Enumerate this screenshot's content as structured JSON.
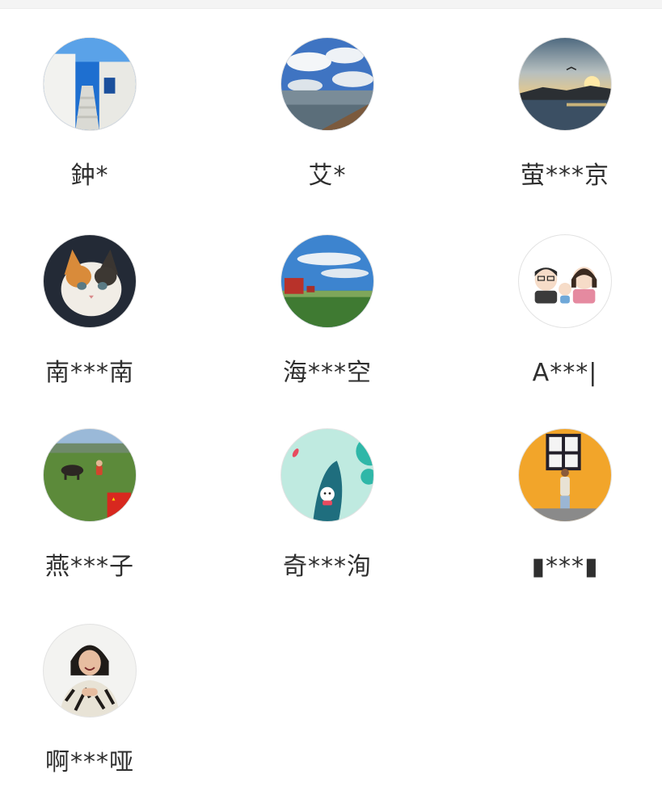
{
  "members": [
    {
      "name": "鈡*",
      "avatar": "white-stairs-blue-sky-photo"
    },
    {
      "name": "艾*",
      "avatar": "sky-clouds-lake-photo"
    },
    {
      "name": "萤***京",
      "avatar": "sunset-over-water-photo"
    },
    {
      "name": "南***南",
      "avatar": "kitten-photo"
    },
    {
      "name": "海***空",
      "avatar": "grassland-red-house-photo"
    },
    {
      "name": "A***|",
      "avatar": "cartoon-family-illustration"
    },
    {
      "name": "燕***子",
      "avatar": "grassland-child-cow-photo"
    },
    {
      "name": "奇***洵",
      "avatar": "mint-boat-illustration"
    },
    {
      "name": "▮***▮",
      "avatar": "orange-wall-window-person-photo"
    },
    {
      "name": "啊***哑",
      "avatar": "laughing-woman-photo"
    }
  ]
}
